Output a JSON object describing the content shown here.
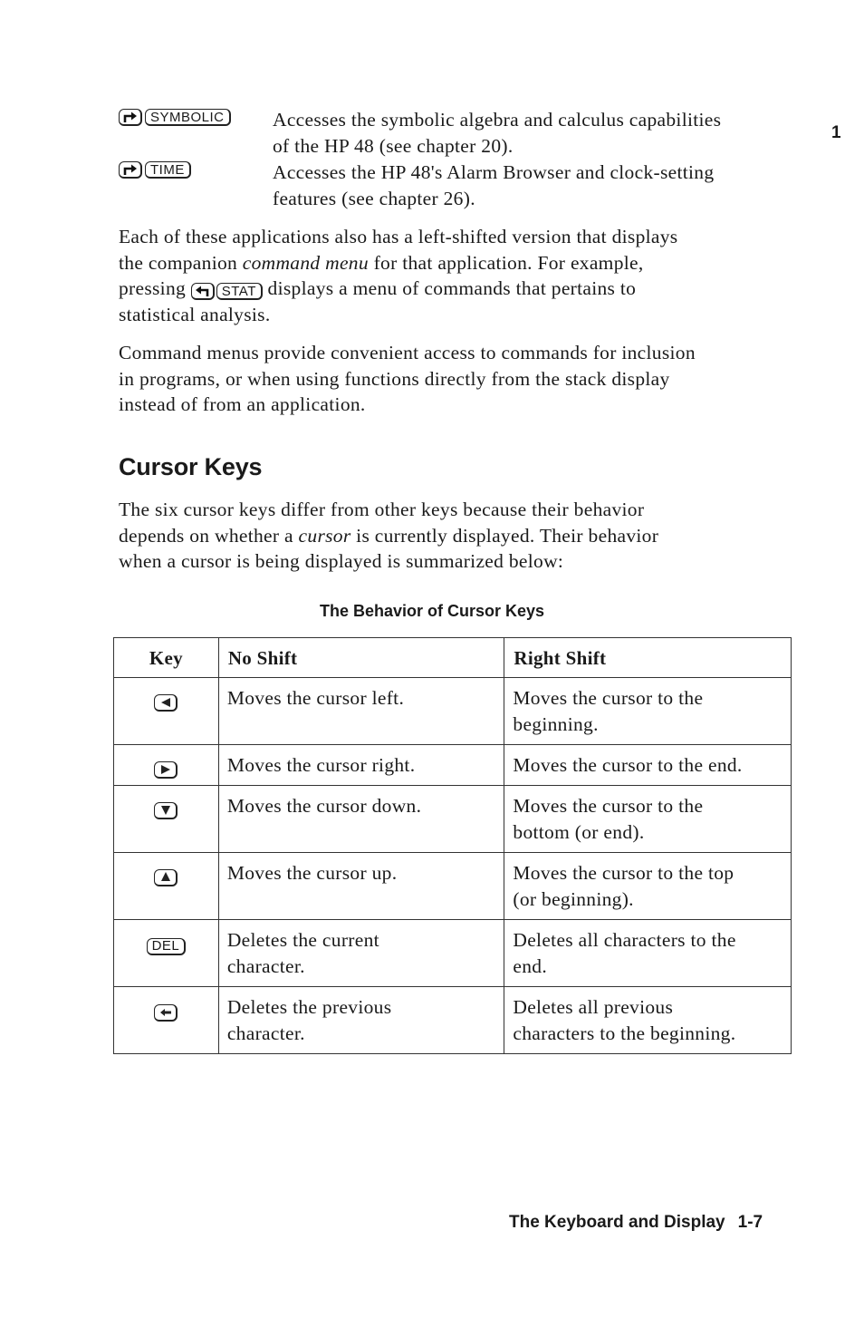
{
  "chapter_tab": "1",
  "definitions": [
    {
      "keys": [
        {
          "type": "icon",
          "icon": "right-shift-icon"
        },
        {
          "type": "text",
          "label": "SYMBOLIC"
        }
      ],
      "lines": [
        "Accesses the symbolic algebra and calculus capabilities",
        "of the HP 48 (see chapter 20)."
      ]
    },
    {
      "keys": [
        {
          "type": "icon",
          "icon": "right-shift-icon"
        },
        {
          "type": "text",
          "label": "TIME"
        }
      ],
      "lines": [
        "Accesses the HP 48's Alarm Browser and clock-setting",
        "features (see chapter 26)."
      ]
    }
  ],
  "para1": {
    "line1": "Each of these applications also has a left-shifted version that displays",
    "line2_pre": "the companion ",
    "line2_em": "command menu",
    "line2_post": " for that application. For example,",
    "line3_pre": "pressing ",
    "line3_key_icon": "left-shift-icon",
    "line3_key_label": "STAT",
    "line3_post": " displays a menu of commands that pertains to",
    "line4": "statistical analysis."
  },
  "para2": {
    "lines": [
      "Command menus provide convenient access to commands for inclusion",
      "in programs, or when using functions directly from the stack display",
      "instead of from an application."
    ]
  },
  "section_heading": "Cursor Keys",
  "para3": {
    "line1": "The six cursor keys differ from other keys because their behavior",
    "line2_pre": "depends on whether a ",
    "line2_em": "cursor",
    "line2_post": " is currently displayed. Their behavior",
    "line3": "when a cursor is being displayed is summarized below:"
  },
  "table": {
    "caption": "The Behavior of Cursor Keys",
    "headers": [
      "Key",
      "No Shift",
      "Right Shift"
    ],
    "rows": [
      {
        "key_icon": "left-arrow-key-icon",
        "key_label": "",
        "no_shift": [
          "Moves the cursor left."
        ],
        "right_shift": [
          "Moves the cursor to the",
          "beginning."
        ]
      },
      {
        "key_icon": "right-arrow-key-icon",
        "key_label": "",
        "no_shift": [
          "Moves the cursor right."
        ],
        "right_shift": [
          "Moves the cursor to the end."
        ]
      },
      {
        "key_icon": "down-arrow-key-icon",
        "key_label": "",
        "no_shift": [
          "Moves the cursor down."
        ],
        "right_shift": [
          "Moves the cursor to the",
          "bottom (or end)."
        ]
      },
      {
        "key_icon": "up-arrow-key-icon",
        "key_label": "",
        "no_shift": [
          "Moves the cursor up."
        ],
        "right_shift": [
          "Moves the cursor to the top",
          "(or beginning)."
        ]
      },
      {
        "key_icon": "del-key-icon",
        "key_label": "DEL",
        "no_shift": [
          "Deletes the current",
          "character."
        ],
        "right_shift": [
          "Deletes all characters to the",
          "end."
        ]
      },
      {
        "key_icon": "backspace-key-icon",
        "key_label": "",
        "no_shift": [
          "Deletes the previous",
          "character."
        ],
        "right_shift": [
          "Deletes all previous",
          "characters to the beginning."
        ]
      }
    ]
  },
  "footer": {
    "title": "The Keyboard and Display",
    "page": "1-7"
  }
}
